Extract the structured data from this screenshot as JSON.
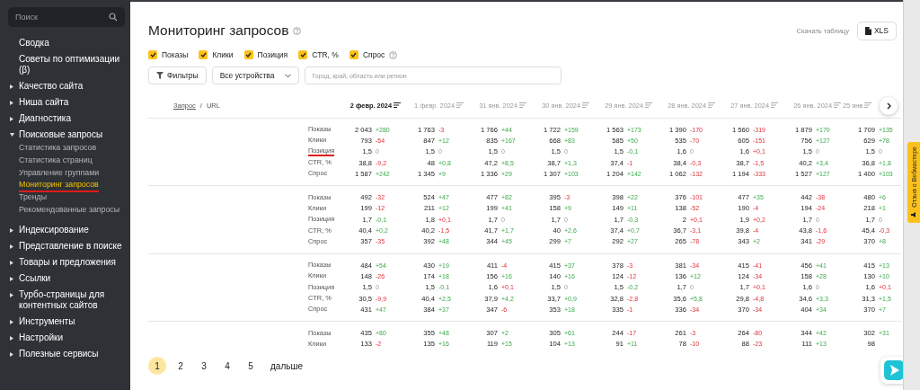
{
  "sidebar": {
    "search": {
      "placeholder": "Поиск"
    },
    "items": [
      {
        "label": "Сводка",
        "kind": "link"
      },
      {
        "label": "Советы по оптимизации (β)",
        "kind": "link"
      },
      {
        "label": "Качество сайта",
        "kind": "section",
        "expanded": false
      },
      {
        "label": "Ниша сайта",
        "kind": "section",
        "expanded": false
      },
      {
        "label": "Диагностика",
        "kind": "section",
        "expanded": false
      },
      {
        "label": "Поисковые запросы",
        "kind": "section",
        "expanded": true,
        "children": [
          {
            "label": "Статистика запросов",
            "selected": false,
            "underlined": false
          },
          {
            "label": "Статистика страниц",
            "selected": false,
            "underlined": false
          },
          {
            "label": "Управление группами",
            "selected": false,
            "underlined": false
          },
          {
            "label": "Мониторинг запросов",
            "selected": true,
            "underlined": true
          },
          {
            "label": "Тренды",
            "selected": false,
            "underlined": false
          },
          {
            "label": "Рекомендованные запросы",
            "selected": false,
            "underlined": false
          }
        ]
      },
      {
        "label": "Индексирование",
        "kind": "section",
        "expanded": false
      },
      {
        "label": "Представление в поиске",
        "kind": "section",
        "expanded": false
      },
      {
        "label": "Товары и предложения",
        "kind": "section",
        "expanded": false
      },
      {
        "label": "Ссылки",
        "kind": "section",
        "expanded": false
      },
      {
        "label": "Турбо-страницы для контентных сайтов",
        "kind": "section",
        "expanded": false
      },
      {
        "label": "Инструменты",
        "kind": "section",
        "expanded": false
      },
      {
        "label": "Настройки",
        "kind": "section",
        "expanded": false
      },
      {
        "label": "Полезные сервисы",
        "kind": "section",
        "expanded": false
      }
    ]
  },
  "page": {
    "title": "Мониторинг запросов",
    "download_label": "Скачать таблицу",
    "download_button": "XLS"
  },
  "metrics": [
    {
      "label": "Показы",
      "checked": true,
      "help": false
    },
    {
      "label": "Клики",
      "checked": true,
      "help": false
    },
    {
      "label": "Позиция",
      "checked": true,
      "help": false
    },
    {
      "label": "CTR, %",
      "checked": true,
      "help": false
    },
    {
      "label": "Спрос",
      "checked": true,
      "help": true
    }
  ],
  "filters": {
    "button": "Фильтры",
    "device": "Все устройства",
    "region": {
      "placeholder": "Город, край, область или регион"
    }
  },
  "table": {
    "query_header": "Запрос",
    "separator": "/",
    "url_header": "URL",
    "columns": [
      {
        "label": "2 февр. 2024",
        "selected": true
      },
      {
        "label": "1 февр. 2024",
        "selected": false
      },
      {
        "label": "31 янв. 2024",
        "selected": false
      },
      {
        "label": "30 янв. 2024",
        "selected": false
      },
      {
        "label": "29 янв. 2024",
        "selected": false
      },
      {
        "label": "28 янв. 2024",
        "selected": false
      },
      {
        "label": "27 янв. 2024",
        "selected": false
      },
      {
        "label": "26 янв. 2024",
        "selected": false
      },
      {
        "label": "25 янв",
        "selected": false
      }
    ],
    "groups": [
      {
        "rows": [
          {
            "label": "Показы",
            "underlined": false,
            "cells": [
              {
                "value": "2 043",
                "delta": "+280",
                "changed": true,
                "improved": true
              },
              {
                "value": "1 763",
                "delta": "-3",
                "changed": true,
                "improved": false
              },
              {
                "value": "1 766",
                "delta": "+44",
                "changed": true,
                "improved": true
              },
              {
                "value": "1 722",
                "delta": "+159",
                "changed": true,
                "improved": true
              },
              {
                "value": "1 563",
                "delta": "+173",
                "changed": true,
                "improved": true
              },
              {
                "value": "1 390",
                "delta": "-170",
                "changed": true,
                "improved": false
              },
              {
                "value": "1 560",
                "delta": "-319",
                "changed": true,
                "improved": false
              },
              {
                "value": "1 879",
                "delta": "+170",
                "changed": true,
                "improved": true
              },
              {
                "value": "1 709",
                "delta": "+135",
                "changed": true,
                "improved": true
              }
            ]
          },
          {
            "label": "Клики",
            "underlined": false,
            "cells": [
              {
                "value": "793",
                "delta": "-54",
                "changed": true,
                "improved": false
              },
              {
                "value": "847",
                "delta": "+12",
                "changed": true,
                "improved": true
              },
              {
                "value": "835",
                "delta": "+167",
                "changed": true,
                "improved": true
              },
              {
                "value": "668",
                "delta": "+83",
                "changed": true,
                "improved": true
              },
              {
                "value": "585",
                "delta": "+50",
                "changed": true,
                "improved": true
              },
              {
                "value": "535",
                "delta": "-70",
                "changed": true,
                "improved": false
              },
              {
                "value": "605",
                "delta": "-151",
                "changed": true,
                "improved": false
              },
              {
                "value": "756",
                "delta": "+127",
                "changed": true,
                "improved": true
              },
              {
                "value": "629",
                "delta": "+78",
                "changed": true,
                "improved": true
              }
            ]
          },
          {
            "label": "Позиция",
            "underlined": true,
            "cells": [
              {
                "value": "1,5",
                "delta": "0",
                "changed": false,
                "improved": false
              },
              {
                "value": "1,5",
                "delta": "0",
                "changed": false,
                "improved": false
              },
              {
                "value": "1,5",
                "delta": "0",
                "changed": false,
                "improved": false
              },
              {
                "value": "1,5",
                "delta": "0",
                "changed": false,
                "improved": false
              },
              {
                "value": "1,5",
                "delta": "-0,1",
                "changed": true,
                "improved": true
              },
              {
                "value": "1,6",
                "delta": "0",
                "changed": false,
                "improved": false
              },
              {
                "value": "1,6",
                "delta": "+0,1",
                "changed": true,
                "improved": false
              },
              {
                "value": "1,5",
                "delta": "0",
                "changed": false,
                "improved": false
              },
              {
                "value": "1,5",
                "delta": "0",
                "changed": false,
                "improved": false
              }
            ]
          },
          {
            "label": "CTR, %",
            "underlined": false,
            "cells": [
              {
                "value": "38,8",
                "delta": "-9,2",
                "changed": true,
                "improved": false
              },
              {
                "value": "48",
                "delta": "+0,8",
                "changed": true,
                "improved": true
              },
              {
                "value": "47,2",
                "delta": "+8,5",
                "changed": true,
                "improved": true
              },
              {
                "value": "38,7",
                "delta": "+1,3",
                "changed": true,
                "improved": true
              },
              {
                "value": "37,4",
                "delta": "-1",
                "changed": true,
                "improved": false
              },
              {
                "value": "38,4",
                "delta": "-0,3",
                "changed": true,
                "improved": false
              },
              {
                "value": "38,7",
                "delta": "-1,5",
                "changed": true,
                "improved": false
              },
              {
                "value": "40,2",
                "delta": "+3,4",
                "changed": true,
                "improved": true
              },
              {
                "value": "36,8",
                "delta": "+1,8",
                "changed": true,
                "improved": true
              }
            ]
          },
          {
            "label": "Спрос",
            "underlined": false,
            "cells": [
              {
                "value": "1 587",
                "delta": "+242",
                "changed": true,
                "improved": true
              },
              {
                "value": "1 345",
                "delta": "+9",
                "changed": true,
                "improved": true
              },
              {
                "value": "1 336",
                "delta": "+29",
                "changed": true,
                "improved": true
              },
              {
                "value": "1 307",
                "delta": "+103",
                "changed": true,
                "improved": true
              },
              {
                "value": "1 204",
                "delta": "+142",
                "changed": true,
                "improved": true
              },
              {
                "value": "1 062",
                "delta": "-132",
                "changed": true,
                "improved": false
              },
              {
                "value": "1 194",
                "delta": "-333",
                "changed": true,
                "improved": false
              },
              {
                "value": "1 527",
                "delta": "+127",
                "changed": true,
                "improved": true
              },
              {
                "value": "1 400",
                "delta": "+103",
                "changed": true,
                "improved": true
              }
            ]
          }
        ]
      },
      {
        "rows": [
          {
            "label": "Показы",
            "underlined": false,
            "cells": [
              {
                "value": "492",
                "delta": "-32",
                "changed": true,
                "improved": false
              },
              {
                "value": "524",
                "delta": "+47",
                "changed": true,
                "improved": true
              },
              {
                "value": "477",
                "delta": "+82",
                "changed": true,
                "improved": true
              },
              {
                "value": "395",
                "delta": "-3",
                "changed": true,
                "improved": false
              },
              {
                "value": "398",
                "delta": "+22",
                "changed": true,
                "improved": true
              },
              {
                "value": "376",
                "delta": "-101",
                "changed": true,
                "improved": false
              },
              {
                "value": "477",
                "delta": "+35",
                "changed": true,
                "improved": true
              },
              {
                "value": "442",
                "delta": "-38",
                "changed": true,
                "improved": false
              },
              {
                "value": "480",
                "delta": "+6",
                "changed": true,
                "improved": true
              }
            ]
          },
          {
            "label": "Клики",
            "underlined": false,
            "cells": [
              {
                "value": "199",
                "delta": "-12",
                "changed": true,
                "improved": false
              },
              {
                "value": "211",
                "delta": "+12",
                "changed": true,
                "improved": true
              },
              {
                "value": "199",
                "delta": "+41",
                "changed": true,
                "improved": true
              },
              {
                "value": "158",
                "delta": "+9",
                "changed": true,
                "improved": true
              },
              {
                "value": "149",
                "delta": "+11",
                "changed": true,
                "improved": true
              },
              {
                "value": "138",
                "delta": "-52",
                "changed": true,
                "improved": false
              },
              {
                "value": "190",
                "delta": "-4",
                "changed": true,
                "improved": false
              },
              {
                "value": "194",
                "delta": "-24",
                "changed": true,
                "improved": false
              },
              {
                "value": "218",
                "delta": "+1",
                "changed": true,
                "improved": true
              }
            ]
          },
          {
            "label": "Позиция",
            "underlined": false,
            "cells": [
              {
                "value": "1,7",
                "delta": "-0,1",
                "changed": true,
                "improved": true
              },
              {
                "value": "1,8",
                "delta": "+0,1",
                "changed": true,
                "improved": false
              },
              {
                "value": "1,7",
                "delta": "0",
                "changed": false,
                "improved": false
              },
              {
                "value": "1,7",
                "delta": "0",
                "changed": false,
                "improved": false
              },
              {
                "value": "1,7",
                "delta": "-0,3",
                "changed": true,
                "improved": true
              },
              {
                "value": "2",
                "delta": "+0,1",
                "changed": true,
                "improved": false
              },
              {
                "value": "1,9",
                "delta": "+0,2",
                "changed": true,
                "improved": false
              },
              {
                "value": "1,7",
                "delta": "0",
                "changed": false,
                "improved": false
              },
              {
                "value": "1,7",
                "delta": "0",
                "changed": false,
                "improved": false
              }
            ]
          },
          {
            "label": "CTR, %",
            "underlined": false,
            "cells": [
              {
                "value": "40,4",
                "delta": "+0,2",
                "changed": true,
                "improved": true
              },
              {
                "value": "40,2",
                "delta": "-1,5",
                "changed": true,
                "improved": false
              },
              {
                "value": "41,7",
                "delta": "+1,7",
                "changed": true,
                "improved": true
              },
              {
                "value": "40",
                "delta": "+2,6",
                "changed": true,
                "improved": true
              },
              {
                "value": "37,4",
                "delta": "+0,7",
                "changed": true,
                "improved": true
              },
              {
                "value": "36,7",
                "delta": "-3,1",
                "changed": true,
                "improved": false
              },
              {
                "value": "39,8",
                "delta": "-4",
                "changed": true,
                "improved": false
              },
              {
                "value": "43,8",
                "delta": "-1,6",
                "changed": true,
                "improved": false
              },
              {
                "value": "45,4",
                "delta": "-0,3",
                "changed": true,
                "improved": false
              }
            ]
          },
          {
            "label": "Спрос",
            "underlined": false,
            "cells": [
              {
                "value": "357",
                "delta": "-35",
                "changed": true,
                "improved": false
              },
              {
                "value": "392",
                "delta": "+48",
                "changed": true,
                "improved": true
              },
              {
                "value": "344",
                "delta": "+45",
                "changed": true,
                "improved": true
              },
              {
                "value": "299",
                "delta": "+7",
                "changed": true,
                "improved": true
              },
              {
                "value": "292",
                "delta": "+27",
                "changed": true,
                "improved": true
              },
              {
                "value": "265",
                "delta": "-78",
                "changed": true,
                "improved": false
              },
              {
                "value": "343",
                "delta": "+2",
                "changed": true,
                "improved": true
              },
              {
                "value": "341",
                "delta": "-29",
                "changed": true,
                "improved": false
              },
              {
                "value": "370",
                "delta": "+8",
                "changed": true,
                "improved": true
              }
            ]
          }
        ]
      },
      {
        "rows": [
          {
            "label": "Показы",
            "underlined": false,
            "cells": [
              {
                "value": "484",
                "delta": "+54",
                "changed": true,
                "improved": true
              },
              {
                "value": "430",
                "delta": "+19",
                "changed": true,
                "improved": true
              },
              {
                "value": "411",
                "delta": "-4",
                "changed": true,
                "improved": false
              },
              {
                "value": "415",
                "delta": "+37",
                "changed": true,
                "improved": true
              },
              {
                "value": "378",
                "delta": "-3",
                "changed": true,
                "improved": false
              },
              {
                "value": "381",
                "delta": "-34",
                "changed": true,
                "improved": false
              },
              {
                "value": "415",
                "delta": "-41",
                "changed": true,
                "improved": false
              },
              {
                "value": "456",
                "delta": "+41",
                "changed": true,
                "improved": true
              },
              {
                "value": "415",
                "delta": "+13",
                "changed": true,
                "improved": true
              }
            ]
          },
          {
            "label": "Клики",
            "underlined": false,
            "cells": [
              {
                "value": "148",
                "delta": "-26",
                "changed": true,
                "improved": false
              },
              {
                "value": "174",
                "delta": "+18",
                "changed": true,
                "improved": true
              },
              {
                "value": "156",
                "delta": "+16",
                "changed": true,
                "improved": true
              },
              {
                "value": "140",
                "delta": "+16",
                "changed": true,
                "improved": true
              },
              {
                "value": "124",
                "delta": "-12",
                "changed": true,
                "improved": false
              },
              {
                "value": "136",
                "delta": "+12",
                "changed": true,
                "improved": true
              },
              {
                "value": "124",
                "delta": "-34",
                "changed": true,
                "improved": false
              },
              {
                "value": "158",
                "delta": "+28",
                "changed": true,
                "improved": true
              },
              {
                "value": "130",
                "delta": "+10",
                "changed": true,
                "improved": true
              }
            ]
          },
          {
            "label": "Позиция",
            "underlined": false,
            "cells": [
              {
                "value": "1,5",
                "delta": "0",
                "changed": false,
                "improved": false
              },
              {
                "value": "1,5",
                "delta": "-0,1",
                "changed": true,
                "improved": true
              },
              {
                "value": "1,6",
                "delta": "+0,1",
                "changed": true,
                "improved": false
              },
              {
                "value": "1,5",
                "delta": "0",
                "changed": false,
                "improved": false
              },
              {
                "value": "1,5",
                "delta": "-0,2",
                "changed": true,
                "improved": true
              },
              {
                "value": "1,7",
                "delta": "0",
                "changed": false,
                "improved": false
              },
              {
                "value": "1,7",
                "delta": "+0,1",
                "changed": true,
                "improved": false
              },
              {
                "value": "1,6",
                "delta": "0",
                "changed": false,
                "improved": false
              },
              {
                "value": "1,6",
                "delta": "+0,1",
                "changed": true,
                "improved": false
              }
            ]
          },
          {
            "label": "CTR, %",
            "underlined": false,
            "cells": [
              {
                "value": "30,5",
                "delta": "-9,9",
                "changed": true,
                "improved": false
              },
              {
                "value": "40,4",
                "delta": "+2,5",
                "changed": true,
                "improved": true
              },
              {
                "value": "37,9",
                "delta": "+4,2",
                "changed": true,
                "improved": true
              },
              {
                "value": "33,7",
                "delta": "+0,9",
                "changed": true,
                "improved": true
              },
              {
                "value": "32,8",
                "delta": "-2,8",
                "changed": true,
                "improved": false
              },
              {
                "value": "35,6",
                "delta": "+5,8",
                "changed": true,
                "improved": true
              },
              {
                "value": "29,8",
                "delta": "-4,8",
                "changed": true,
                "improved": false
              },
              {
                "value": "34,6",
                "delta": "+3,3",
                "changed": true,
                "improved": true
              },
              {
                "value": "31,3",
                "delta": "+1,5",
                "changed": true,
                "improved": true
              }
            ]
          },
          {
            "label": "Спрос",
            "underlined": false,
            "cells": [
              {
                "value": "431",
                "delta": "+47",
                "changed": true,
                "improved": true
              },
              {
                "value": "384",
                "delta": "+37",
                "changed": true,
                "improved": true
              },
              {
                "value": "347",
                "delta": "-6",
                "changed": true,
                "improved": false
              },
              {
                "value": "353",
                "delta": "+18",
                "changed": true,
                "improved": true
              },
              {
                "value": "335",
                "delta": "-1",
                "changed": true,
                "improved": false
              },
              {
                "value": "336",
                "delta": "-34",
                "changed": true,
                "improved": false
              },
              {
                "value": "370",
                "delta": "-34",
                "changed": true,
                "improved": false
              },
              {
                "value": "404",
                "delta": "+34",
                "changed": true,
                "improved": true
              },
              {
                "value": "370",
                "delta": "+7",
                "changed": true,
                "improved": true
              }
            ]
          }
        ]
      },
      {
        "rows": [
          {
            "label": "Показы",
            "underlined": false,
            "cells": [
              {
                "value": "435",
                "delta": "+80",
                "changed": true,
                "improved": true
              },
              {
                "value": "355",
                "delta": "+48",
                "changed": true,
                "improved": true
              },
              {
                "value": "307",
                "delta": "+2",
                "changed": true,
                "improved": true
              },
              {
                "value": "305",
                "delta": "+61",
                "changed": true,
                "improved": true
              },
              {
                "value": "244",
                "delta": "-17",
                "changed": true,
                "improved": false
              },
              {
                "value": "261",
                "delta": "-3",
                "changed": true,
                "improved": false
              },
              {
                "value": "264",
                "delta": "-80",
                "changed": true,
                "improved": false
              },
              {
                "value": "344",
                "delta": "+42",
                "changed": true,
                "improved": true
              },
              {
                "value": "302",
                "delta": "+31",
                "changed": true,
                "improved": true
              }
            ]
          },
          {
            "label": "Клики",
            "underlined": false,
            "cells": [
              {
                "value": "133",
                "delta": "-2",
                "changed": true,
                "improved": false
              },
              {
                "value": "135",
                "delta": "+16",
                "changed": true,
                "improved": true
              },
              {
                "value": "119",
                "delta": "+15",
                "changed": true,
                "improved": true
              },
              {
                "value": "104",
                "delta": "+13",
                "changed": true,
                "improved": true
              },
              {
                "value": "91",
                "delta": "+11",
                "changed": true,
                "improved": true
              },
              {
                "value": "78",
                "delta": "-10",
                "changed": true,
                "improved": false
              },
              {
                "value": "88",
                "delta": "-23",
                "changed": true,
                "improved": false
              },
              {
                "value": "111",
                "delta": "+13",
                "changed": true,
                "improved": true
              },
              {
                "value": "98"
              }
            ]
          }
        ]
      }
    ]
  },
  "pagination": {
    "pages": [
      {
        "label": "1",
        "selected": true
      },
      {
        "label": "2",
        "selected": false
      },
      {
        "label": "3",
        "selected": false
      },
      {
        "label": "4",
        "selected": false
      },
      {
        "label": "5",
        "selected": false
      }
    ],
    "next": "дальше"
  },
  "feedback_tab": {
    "label": "Отзыв о Вебмастере"
  }
}
